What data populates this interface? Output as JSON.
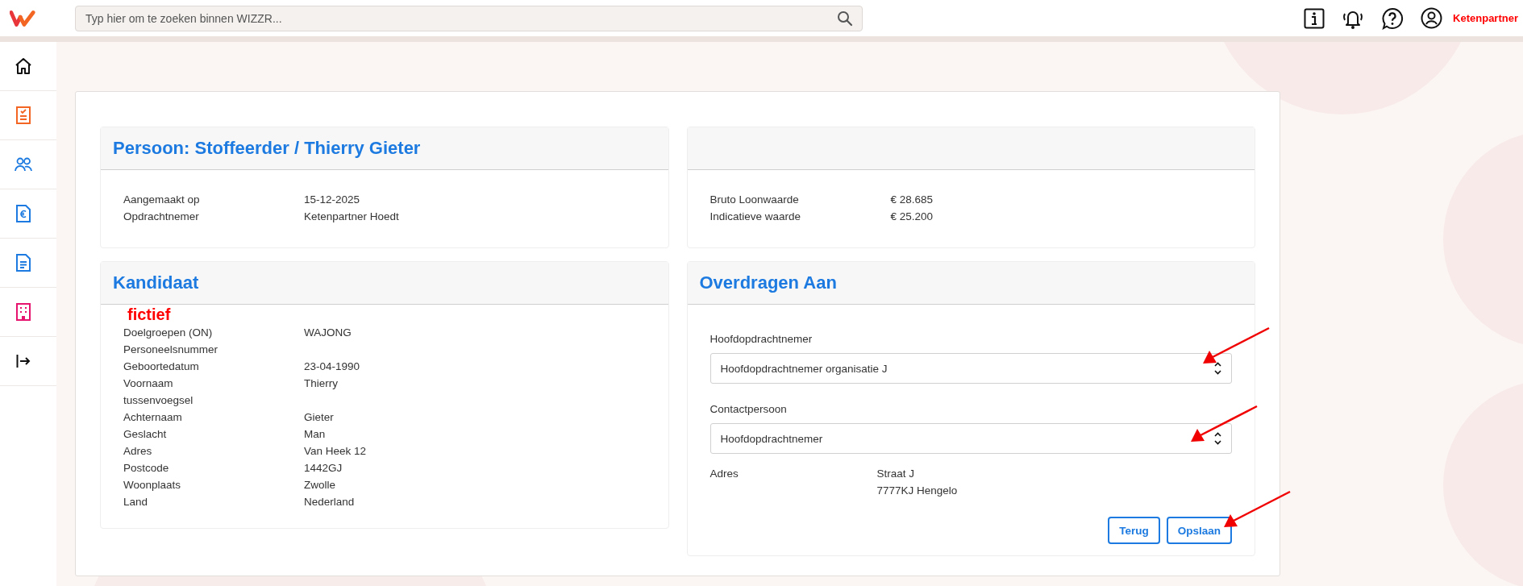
{
  "header": {
    "search": {
      "placeholder": "Typ hier om te zoeken binnen WIZZR..."
    },
    "user_label": "Ketenpartner"
  },
  "person_card": {
    "title": "Persoon: Stoffeerder / Thierry Gieter",
    "fields": [
      {
        "label": "Aangemaakt op",
        "value": "15-12-2025"
      },
      {
        "label": "Opdrachtnemer",
        "value": "Ketenpartner Hoedt"
      }
    ]
  },
  "value_card": {
    "fields": [
      {
        "label": "Bruto Loonwaarde",
        "value": "€ 28.685"
      },
      {
        "label": "Indicatieve waarde",
        "value": "€ 25.200"
      }
    ]
  },
  "candidate_card": {
    "title": "Kandidaat",
    "annotation": "fictief",
    "fields": [
      {
        "label": "Doelgroepen (ON)",
        "value": "WAJONG"
      },
      {
        "label": "Personeelsnummer"
      },
      {
        "label": "Geboortedatum",
        "value": "23-04-1990"
      },
      {
        "label": "Voornaam",
        "value": "Thierry"
      },
      {
        "label": "tussenvoegsel"
      },
      {
        "label": "Achternaam",
        "value": "Gieter"
      },
      {
        "label": "Geslacht",
        "value": "Man"
      },
      {
        "label": "Adres",
        "value": "Van Heek 12"
      },
      {
        "label": "Postcode",
        "value": "1442GJ"
      },
      {
        "label": "Woonplaats",
        "value": "Zwolle"
      },
      {
        "label": "Land",
        "value": "Nederland"
      }
    ]
  },
  "transfer_card": {
    "title": "Overdragen Aan",
    "selects": [
      {
        "label": "Hoofdopdrachtnemer",
        "value": "Hoofdopdrachtnemer organisatie J"
      },
      {
        "label": "Contactpersoon",
        "value": "Hoofdopdrachtnemer"
      }
    ],
    "address": {
      "label": "Adres",
      "lines": [
        "Straat J",
        "7777KJ Hengelo"
      ]
    },
    "buttons": [
      "Terug",
      "Opslaan"
    ]
  }
}
